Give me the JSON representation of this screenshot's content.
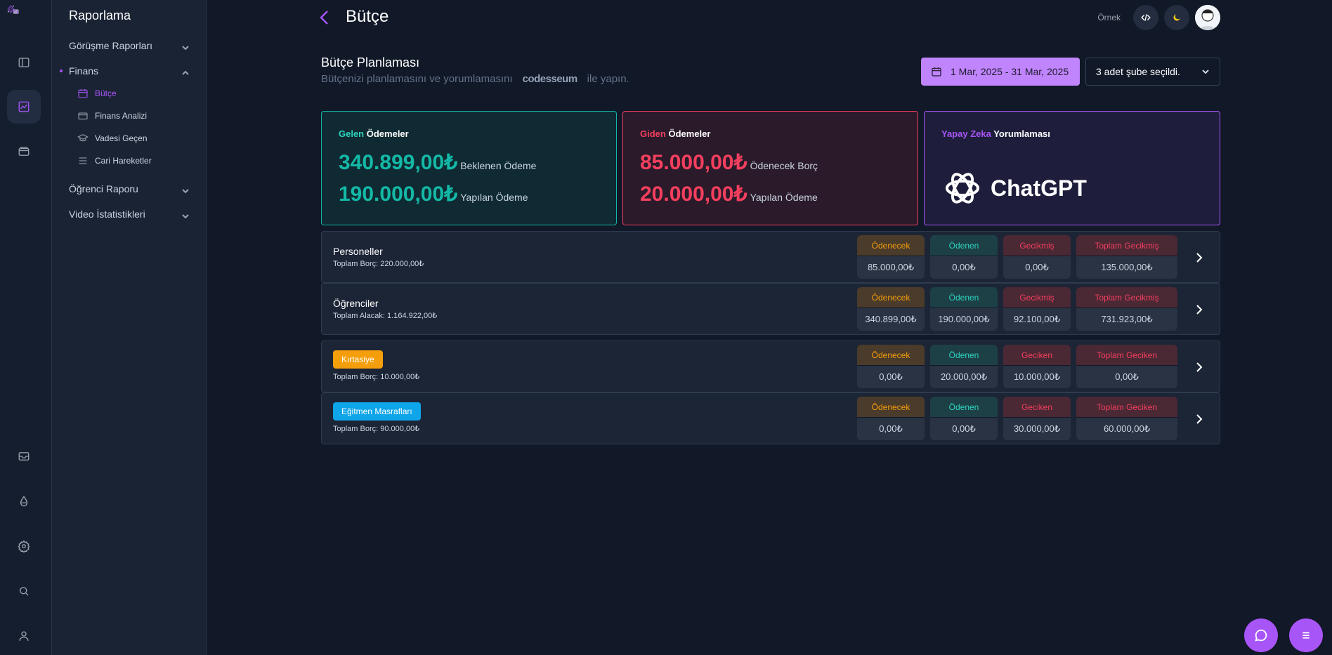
{
  "sidebar": {
    "title": "Raporlama",
    "menus": [
      {
        "label": "Görüşme Raporları"
      },
      {
        "label": "Finans"
      },
      {
        "label": "Öğrenci Raporu"
      },
      {
        "label": "Video İstatistikleri"
      }
    ],
    "finans_items": [
      {
        "label": "Bütçe",
        "icon": "calendar-icon"
      },
      {
        "label": "Finans Analizi",
        "icon": "wallet-icon"
      },
      {
        "label": "Vadesi Geçen",
        "icon": "graduation-cap-icon"
      },
      {
        "label": "Cari Hareketler",
        "icon": "list-icon"
      }
    ]
  },
  "header": {
    "title": "Bütçe",
    "example_label": "Örnek"
  },
  "section": {
    "title": "Bütçe Planlaması",
    "subtitle_before": "Bütçenizi planlamasını ve yorumlamasını",
    "brand": "codesseum",
    "subtitle_after": "ile yapın.",
    "date_range": "1 Mar, 2025 - 31 Mar, 2025",
    "branch_select": "3 adet şube seçildi."
  },
  "cards": {
    "incoming": {
      "title_hl": "Gelen",
      "title": "Ödemeler",
      "v1": "340.899,00₺",
      "l1": "Beklenen Ödeme",
      "v2": "190.000,00₺",
      "l2": "Yapılan Ödeme"
    },
    "outgoing": {
      "title_hl": "Giden",
      "title": "Ödemeler",
      "v1": "85.000,00₺",
      "l1": "Ödenecek Borç",
      "v2": "20.000,00₺",
      "l2": "Yapılan Ödeme"
    },
    "ai": {
      "title_hl": "Yapay Zeka",
      "title": "Yorumlaması",
      "brand": "ChatGPT"
    }
  },
  "rows": [
    {
      "name": "Personeller",
      "total": "Toplam Borç: 220.000,00₺",
      "h1": "Ödenecek",
      "v1": "85.000,00₺",
      "h2": "Ödenen",
      "v2": "0,00₺",
      "h3": "Gecikmiş",
      "v3": "0,00₺",
      "h4": "Toplam Gecikmiş",
      "v4": "135.000,00₺"
    },
    {
      "name": "Öğrenciler",
      "total": "Toplam Alacak: 1.164.922,00₺",
      "h1": "Ödenecek",
      "v1": "340.899,00₺",
      "h2": "Ödenen",
      "v2": "190.000,00₺",
      "h3": "Gecikmiş",
      "v3": "92.100,00₺",
      "h4": "Toplam Gecikmiş",
      "v4": "731.923,00₺"
    },
    {
      "name": "Kırtasiye",
      "tag_color": "#f59e0b",
      "total": "Toplam Borç: 10.000,00₺",
      "h1": "Ödenecek",
      "v1": "0,00₺",
      "h2": "Ödenen",
      "v2": "20.000,00₺",
      "h3": "Geciken",
      "v3": "10.000,00₺",
      "h4": "Toplam Geciken",
      "v4": "0,00₺"
    },
    {
      "name": "Eğitmen Masrafları",
      "tag_color": "#0ea5e9",
      "total": "Toplam Borç: 90.000,00₺",
      "h1": "Ödenecek",
      "v1": "0,00₺",
      "h2": "Ödenen",
      "v2": "0,00₺",
      "h3": "Geciken",
      "v3": "30.000,00₺",
      "h4": "Toplam Geciken",
      "v4": "60.000,00₺"
    }
  ],
  "colors": {
    "accent": "#a855f7",
    "teal": "#14b8a6",
    "red": "#f43f5e",
    "amber": "#f59e0b",
    "background": "#111827"
  }
}
